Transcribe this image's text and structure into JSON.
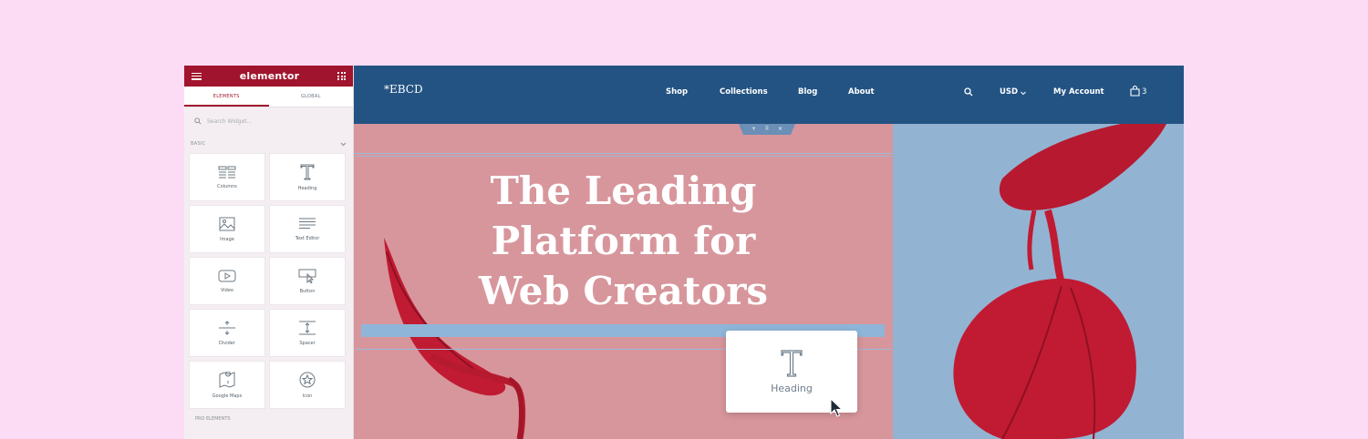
{
  "editor": {
    "brand": "elementor",
    "tabs": [
      "ELEMENTS",
      "GLOBAL"
    ],
    "search_placeholder": "Search Widget...",
    "category": "BASIC",
    "widgets": [
      {
        "label": "Columns",
        "icon": "columns-icon"
      },
      {
        "label": "Heading",
        "icon": "heading-icon"
      },
      {
        "label": "Image",
        "icon": "image-icon"
      },
      {
        "label": "Text Editor",
        "icon": "text-editor-icon"
      },
      {
        "label": "Video",
        "icon": "video-icon"
      },
      {
        "label": "Button",
        "icon": "button-icon"
      },
      {
        "label": "Divider",
        "icon": "divider-icon"
      },
      {
        "label": "Spacer",
        "icon": "spacer-icon"
      },
      {
        "label": "Google Maps",
        "icon": "google-maps-icon"
      },
      {
        "label": "Icon",
        "icon": "star-icon"
      }
    ],
    "pro_label": "PRO ELEMENTS"
  },
  "site": {
    "logo": "*EBCD",
    "nav": [
      "Shop",
      "Collections",
      "Blog",
      "About"
    ],
    "currency": "USD",
    "account": "My Account",
    "cart_count": "3",
    "hero_lines": [
      "The Leading",
      "Platform for",
      "Web Creators"
    ]
  },
  "drag": {
    "label": "Heading"
  },
  "colors": {
    "editor_brand": "#a1142d",
    "nav_bg": "#235383",
    "hero_pink": "#d7969c",
    "hero_blue": "#93b3d2",
    "flower_red": "#c01b32"
  }
}
